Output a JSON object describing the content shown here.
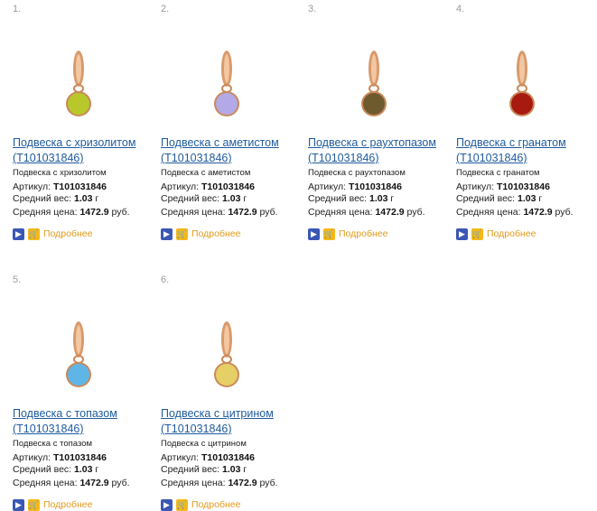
{
  "colors": {
    "link": "#1f5b9e",
    "more": "#e09a1a",
    "gold": "#d89a6c"
  },
  "labels": {
    "article": "Артикул:",
    "weight": "Средний вес:",
    "price": "Средняя цена:",
    "more": "Подробнее"
  },
  "products": [
    {
      "num": "1.",
      "title": "Подвеска с хризолитом (T101031846)",
      "desc": "Подвеска с хризолитом",
      "article": "T101031846",
      "weight": "1.03",
      "weight_unit": "г",
      "price": "1472.9",
      "price_unit": "руб.",
      "gem_color": "#b8c82a"
    },
    {
      "num": "2.",
      "title": "Подвеска с аметистом (T101031846)",
      "desc": "Подвеска с аметистом",
      "article": "T101031846",
      "weight": "1.03",
      "weight_unit": "г",
      "price": "1472.9",
      "price_unit": "руб.",
      "gem_color": "#b3a9e6"
    },
    {
      "num": "3.",
      "title": "Подвеска с раухтопазом (T101031846)",
      "desc": "Подвеска с раухтопазом",
      "article": "T101031846",
      "weight": "1.03",
      "weight_unit": "г",
      "price": "1472.9",
      "price_unit": "руб.",
      "gem_color": "#6e5a2d"
    },
    {
      "num": "4.",
      "title": "Подвеска с гранатом (T101031846)",
      "desc": "Подвеска с гранатом",
      "article": "T101031846",
      "weight": "1.03",
      "weight_unit": "г",
      "price": "1472.9",
      "price_unit": "руб.",
      "gem_color": "#a8190f"
    },
    {
      "num": "5.",
      "title": "Подвеска с топазом (T101031846)",
      "desc": "Подвеска с топазом",
      "article": "T101031846",
      "weight": "1.03",
      "weight_unit": "г",
      "price": "1472.9",
      "price_unit": "руб.",
      "gem_color": "#5fb6e6"
    },
    {
      "num": "6.",
      "title": "Подвеска с цитрином (T101031846)",
      "desc": "Подвеска с цитрином",
      "article": "T101031846",
      "weight": "1.03",
      "weight_unit": "г",
      "price": "1472.9",
      "price_unit": "руб.",
      "gem_color": "#e6cf65"
    }
  ]
}
